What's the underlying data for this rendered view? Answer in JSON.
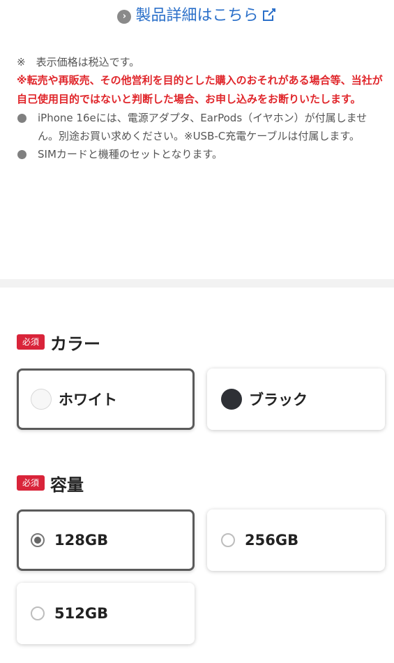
{
  "detail_link": {
    "label": "製品詳細はこちら"
  },
  "notes": {
    "tax": "※　表示価格は税込です。",
    "warning": "※転売や再販売、その他営利を目的とした購入のおそれがある場合等、当社が自己使用目的ではないと判断した場合、お申し込みをお断りいたします。",
    "bullets": [
      "iPhone 16eには、電源アダプタ、EarPods（イヤホン）が付属しません。別途お買い求めください。※USB-C充電ケーブルは付属します。",
      "SIMカードと機種のセットとなります。"
    ]
  },
  "color_section": {
    "badge": "必須",
    "title": "カラー",
    "options": [
      {
        "label": "ホワイト",
        "swatch": "#f7f7f7",
        "selected": true
      },
      {
        "label": "ブラック",
        "swatch": "#2e3035",
        "selected": false
      }
    ]
  },
  "capacity_section": {
    "badge": "必須",
    "title": "容量",
    "options": [
      {
        "label": "128GB",
        "selected": true
      },
      {
        "label": "256GB",
        "selected": false
      },
      {
        "label": "512GB",
        "selected": false
      }
    ]
  },
  "colors": {
    "link": "#2a6fc9",
    "warning": "#e0262b",
    "badge": "#d9243a"
  }
}
